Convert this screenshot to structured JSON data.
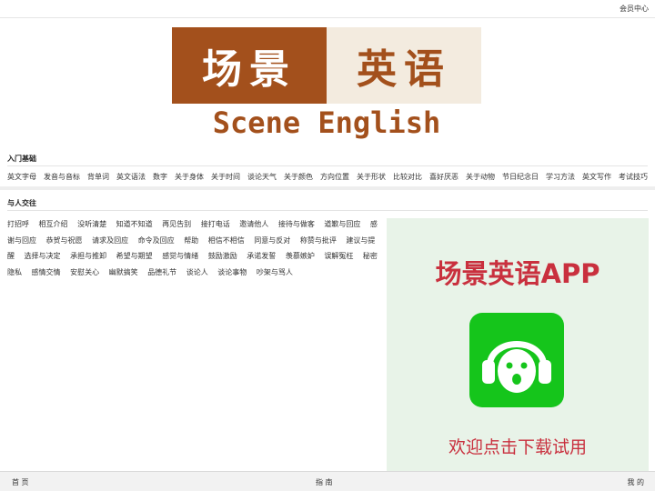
{
  "header": {
    "member_center": "会员中心"
  },
  "logo": {
    "cn_part1": "场景",
    "cn_part2": "英语",
    "en": "Scene English"
  },
  "section1": {
    "title": "入门基础",
    "links": [
      "英文字母",
      "发音与音标",
      "背单词",
      "英文语法",
      "数字",
      "关于身体",
      "关于时间",
      "谈论天气",
      "关于颜色",
      "方向位置",
      "关于形状",
      "比较对比",
      "喜好厌恶",
      "关于动物",
      "节日纪念日",
      "学习方法",
      "英文写作",
      "考试技巧"
    ]
  },
  "section2": {
    "title": "与人交往",
    "links": [
      "打招呼",
      "相互介绍",
      "没听清楚",
      "知道不知道",
      "再见告别",
      "接打电话",
      "邀请他人",
      "接待与做客",
      "道歉与回应",
      "感谢与回应",
      "恭贺与祝愿",
      "请求及回应",
      "命令及回应",
      "帮助",
      "相信不相信",
      "同意与反对",
      "称赞与批评",
      "建议与提醒",
      "选择与决定",
      "承担与推卸",
      "希望与期望",
      "感觉与情绪",
      "鼓励激励",
      "承诺发誓",
      "羡慕嫉妒",
      "误解冤枉",
      "秘密隐私",
      "感情交情",
      "安慰关心",
      "幽默搞笑",
      "品德礼节",
      "谈论人",
      "谈论事物",
      "吵架与骂人"
    ]
  },
  "ad": {
    "title": "场景英语APP",
    "cta": "欢迎点击下载试用",
    "icon": "headphones-robot-icon"
  },
  "tabbar": {
    "home": "首 页",
    "guide": "指 南",
    "mine": "我 的"
  },
  "colors": {
    "brand": "#a3501c",
    "ad_red": "#c9303e",
    "app_green": "#15c51b"
  }
}
